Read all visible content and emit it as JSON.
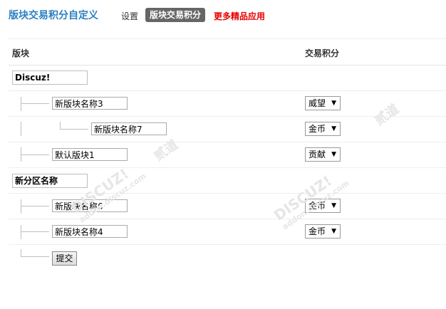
{
  "header": {
    "title": "版块交易积分自定义",
    "nav": {
      "settings": "设置",
      "active": "版块交易积分",
      "more": "更多精品应用"
    }
  },
  "table": {
    "col_forum": "版块",
    "col_credit": "交易积分"
  },
  "groups": [
    {
      "name": "Discuz!",
      "forums": [
        {
          "name": "新版块名称3",
          "credit": "威望"
        },
        {
          "name": "新版块名称7",
          "credit": "金币"
        },
        {
          "name": "默认版块1",
          "credit": "贡献"
        }
      ]
    },
    {
      "name": "新分区名称",
      "forums": [
        {
          "name": "新版块名称6",
          "credit": "金币"
        },
        {
          "name": "新版块名称4",
          "credit": "金币"
        }
      ]
    }
  ],
  "submit_label": "提交",
  "watermark": {
    "brand": "DISCUZ!",
    "url": "addon.discuz.com",
    "seal": "贰道"
  },
  "colors": {
    "title": "#2b7fc1",
    "active_tab_bg": "#666666",
    "more_link": "#e60000"
  }
}
